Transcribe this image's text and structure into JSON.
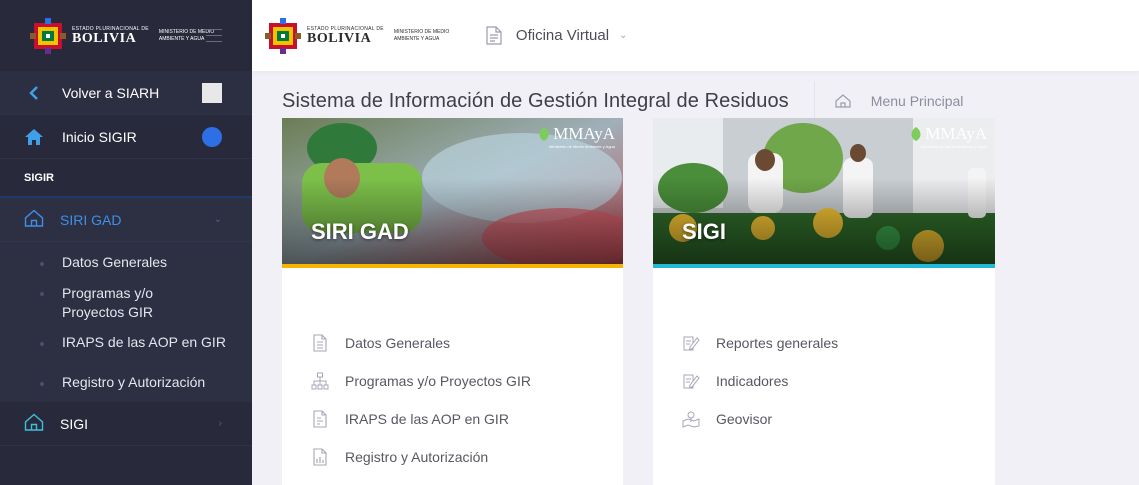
{
  "sidebar": {
    "brand": {
      "small": "ESTADO PLURINACIONAL DE",
      "big": "BOLIVIA",
      "ministry": "MINISTERIO DE MEDIO AMBIENTE Y AGUA"
    },
    "back_label": "Volver a SIARH",
    "home_label": "Inicio SIGIR",
    "section_title": "SIGIR",
    "siri_gad": {
      "label": "SIRI GAD",
      "items": [
        "Datos Generales",
        "Programas y/o Proyectos GIR",
        "IRAPS de las AOP en GIR",
        "Registro y Autorización"
      ]
    },
    "sigi_label": "SIGI"
  },
  "header": {
    "brand": {
      "small": "ESTADO PLURINACIONAL DE",
      "big": "BOLIVIA",
      "ministry": "MINISTERIO DE MEDIO AMBIENTE Y AGUA"
    },
    "menu_label": "Oficina Virtual"
  },
  "subheader": {
    "title": "Sistema de Información de Gestión Integral de Residuos",
    "breadcrumb": "Menu Principal"
  },
  "cards": [
    {
      "title": "SIRI GAD",
      "logo": "MMAyA",
      "logo_sub": "Ministerio de Medio Ambiente y Agua",
      "accent": "#f4b400",
      "items": [
        {
          "label": "Datos Generales",
          "icon": "document-icon"
        },
        {
          "label": "Programas y/o Proyectos GIR",
          "icon": "sitemap-icon"
        },
        {
          "label": "IRAPS de las AOP en GIR",
          "icon": "file-list-icon"
        },
        {
          "label": "Registro y Autorización",
          "icon": "file-chart-icon"
        }
      ]
    },
    {
      "title": "SIGI",
      "logo": "MMAyA",
      "logo_sub": "Ministerio de Medio Ambiente y Agua",
      "accent": "#22b9d6",
      "items": [
        {
          "label": "Reportes generales",
          "icon": "edit-note-icon"
        },
        {
          "label": "Indicadores",
          "icon": "edit-note-icon"
        },
        {
          "label": "Geovisor",
          "icon": "map-icon"
        }
      ]
    }
  ]
}
